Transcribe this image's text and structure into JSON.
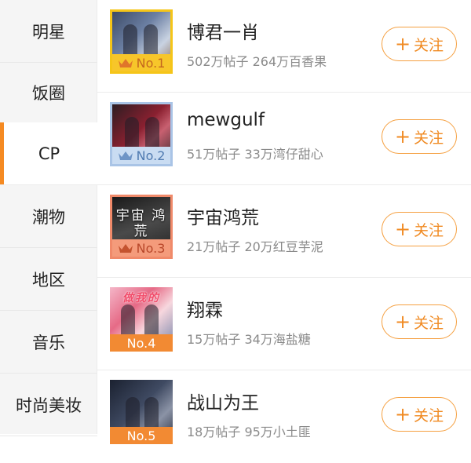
{
  "sidebar": {
    "items": [
      {
        "label": "明星"
      },
      {
        "label": "饭圈"
      },
      {
        "label": "CP",
        "active": true
      },
      {
        "label": "潮物"
      },
      {
        "label": "地区"
      },
      {
        "label": "音乐"
      },
      {
        "label": "时尚美妆"
      }
    ]
  },
  "colors": {
    "accent": "#f58a22",
    "gold": "#f7c62a",
    "silver": "#c9dcf2",
    "bronze": "#f49b7b"
  },
  "list": {
    "follow_label": "关注",
    "follow_plus": "+",
    "items": [
      {
        "name": "博君一肖",
        "stats": "502万帖子 264万百香果",
        "rank": "No.1",
        "thumb_text": ""
      },
      {
        "name": "mewgulf",
        "stats": "51万帖子 33万湾仔甜心",
        "rank": "No.2",
        "thumb_text": ""
      },
      {
        "name": "宇宙鸿荒",
        "stats": "21万帖子 20万红豆芋泥",
        "rank": "No.3",
        "thumb_text": "宇宙 鸿荒"
      },
      {
        "name": "翔霖",
        "stats": "15万帖子 34万海盐糖",
        "rank": "No.4",
        "thumb_text": "做我的"
      },
      {
        "name": "战山为王",
        "stats": "18万帖子 95万小土匪",
        "rank": "No.5",
        "thumb_text": ""
      }
    ]
  }
}
